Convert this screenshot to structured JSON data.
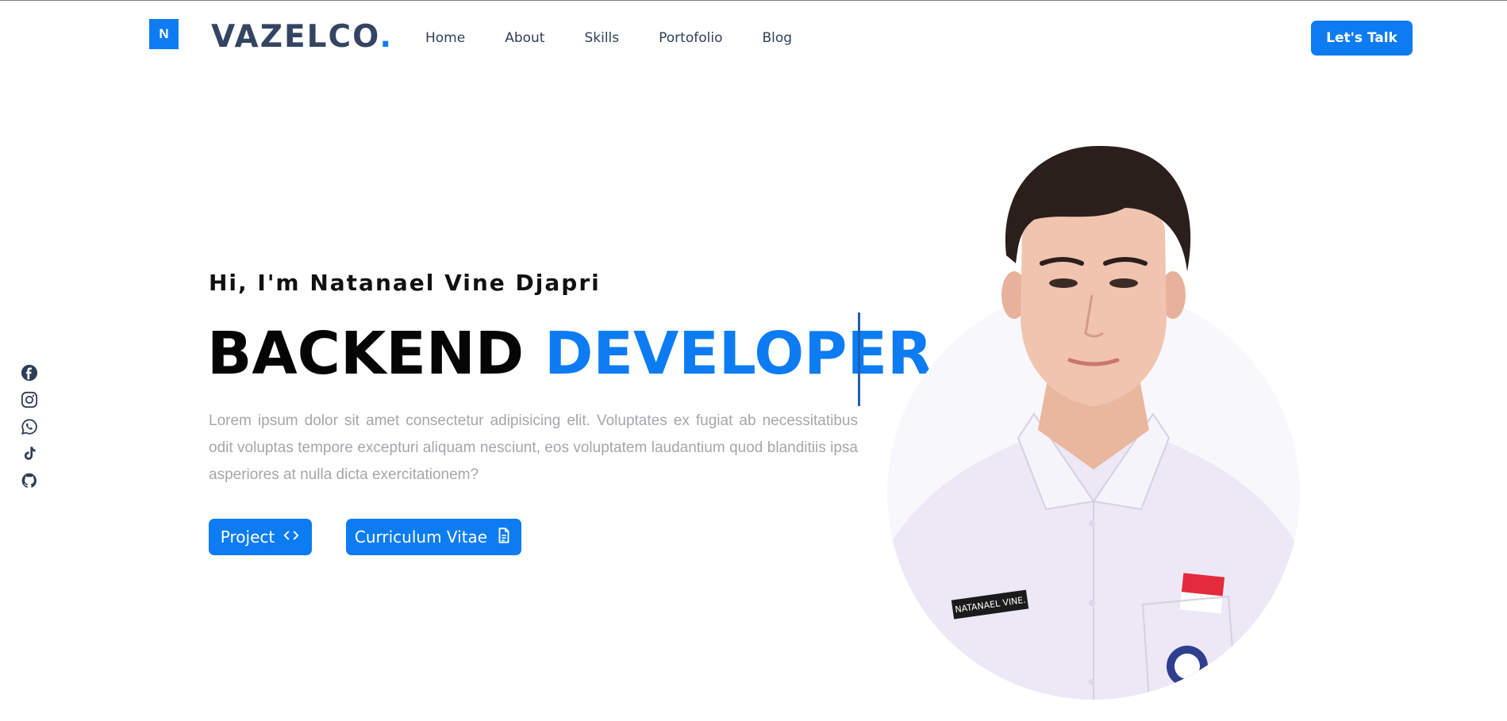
{
  "header": {
    "logo_mark": "N",
    "brand_name": "VAZELCO",
    "brand_dot": ".",
    "nav": [
      "Home",
      "About",
      "Skills",
      "Portofolio",
      "Blog"
    ],
    "cta_label": "Let's Talk"
  },
  "socials": [
    {
      "icon": "facebook-icon"
    },
    {
      "icon": "instagram-icon"
    },
    {
      "icon": "whatsapp-icon"
    },
    {
      "icon": "tiktok-icon"
    },
    {
      "icon": "github-icon"
    }
  ],
  "hero": {
    "greeting": "Hi, I'm Natanael Vine Djapri",
    "headline_primary": "BACKEND ",
    "headline_accent": "DEVELOPER",
    "description": "Lorem ipsum dolor sit amet consectetur adipisicing elit. Voluptates ex fugiat ab necessitatibus odit voluptas tempore excepturi aliquam nesciunt, eos voluptatem laudantium quod blanditiis ipsa asperiores at nulla dicta exercitationem?",
    "buttons": {
      "project_label": "Project",
      "cv_label": "Curriculum Vitae"
    },
    "photo_badge_text": "NATANAEL VINE."
  },
  "colors": {
    "accent": "#0d7cf2",
    "brand_text": "#344563",
    "body_text": "#a3a7ad"
  }
}
